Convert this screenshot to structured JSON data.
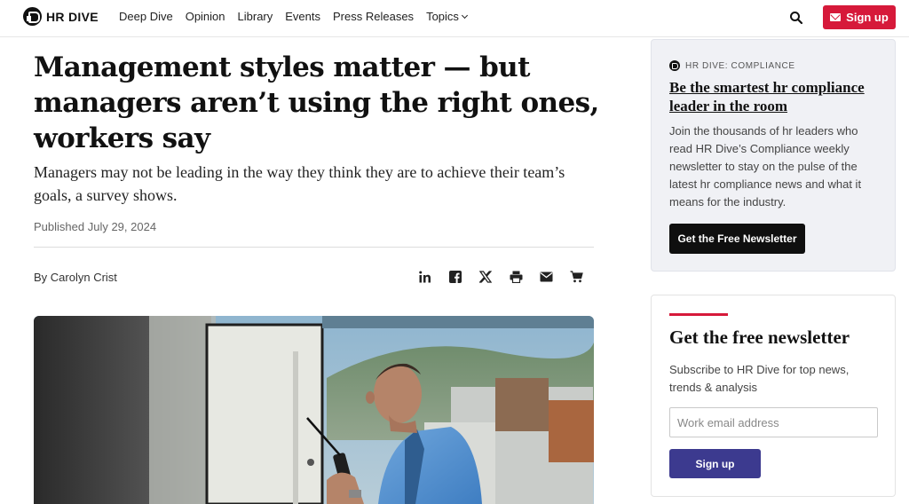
{
  "header": {
    "logo_text": "HR DIVE",
    "nav": [
      "Deep Dive",
      "Opinion",
      "Library",
      "Events",
      "Press Releases",
      "Topics"
    ],
    "signup_label": "Sign up",
    "search_icon": "search-icon"
  },
  "article": {
    "headline": "Management styles matter — but managers aren’t using the right ones, workers say",
    "dek": "Managers may not be leading in the way they think they are to achieve their team’s goals, a survey shows.",
    "published": "Published July 29, 2024",
    "byline": "By Carolyn Crist",
    "share_icons": [
      "linkedin-icon",
      "facebook-icon",
      "x-icon",
      "print-icon",
      "email-icon",
      "cart-icon"
    ]
  },
  "promo": {
    "brand": "HR DIVE: COMPLIANCE",
    "title": "Be the smartest hr compliance leader in the room",
    "body": "Join the thousands of hr leaders who read HR Dive’s Compliance weekly newsletter to stay on the pulse of the latest hr compliance news and what it means for the industry.",
    "button": "Get the Free Newsletter"
  },
  "newsletter": {
    "title": "Get the free newsletter",
    "body": "Subscribe to HR Dive for top news, trends & analysis",
    "email_placeholder": "Work email address",
    "button": "Sign up"
  },
  "colors": {
    "accent_red": "#d6193a",
    "button_purple": "#3c3a8f",
    "promo_bg": "#f0f1f5"
  }
}
